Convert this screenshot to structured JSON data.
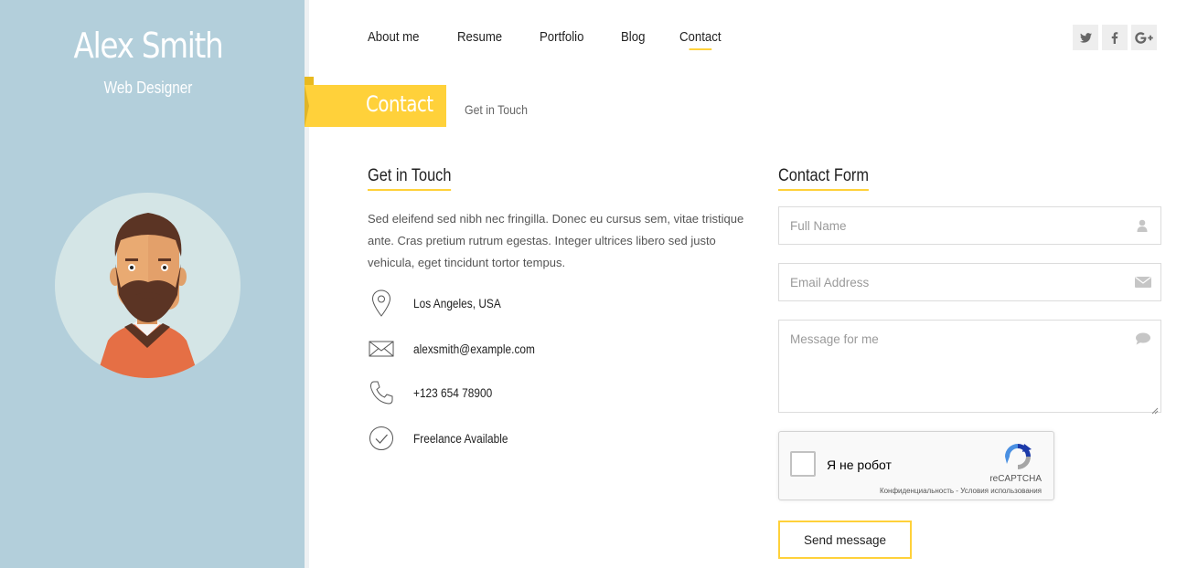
{
  "profile": {
    "name": "Alex Smith",
    "role": "Web Designer"
  },
  "nav": {
    "items": [
      "About me",
      "Resume",
      "Portfolio",
      "Blog",
      "Contact"
    ],
    "active": "Contact"
  },
  "socials": {
    "twitter": "twitter-icon",
    "facebook": "facebook-icon",
    "google_plus": "google-plus-icon"
  },
  "page": {
    "title": "Contact",
    "subtitle": "Get in Touch"
  },
  "get_in_touch": {
    "heading": "Get in Touch",
    "intro": "Sed eleifend sed nibh nec fringilla. Donec eu cursus sem, vitae tristique ante. Cras pretium rutrum egestas. Integer ultrices libero sed justo vehicula, eget tincidunt tortor tempus.",
    "items": [
      {
        "icon": "location-pin-icon",
        "text": "Los Angeles, USA"
      },
      {
        "icon": "envelope-icon",
        "text": "alexsmith@example.com"
      },
      {
        "icon": "phone-icon",
        "text": "+123 654 78900"
      },
      {
        "icon": "check-circle-icon",
        "text": "Freelance Available"
      }
    ]
  },
  "contact_form": {
    "heading": "Contact Form",
    "name_placeholder": "Full Name",
    "email_placeholder": "Email Address",
    "message_placeholder": "Message for me",
    "captcha_label": "Я не робот",
    "captcha_brand": "reCAPTCHA",
    "captcha_links": "Конфиденциальность - Условия использования",
    "send_label": "Send message"
  },
  "colors": {
    "sidebar": "#b3cfdb",
    "accent": "#ffd13a",
    "avatar_bg": "#d4e5e6"
  }
}
